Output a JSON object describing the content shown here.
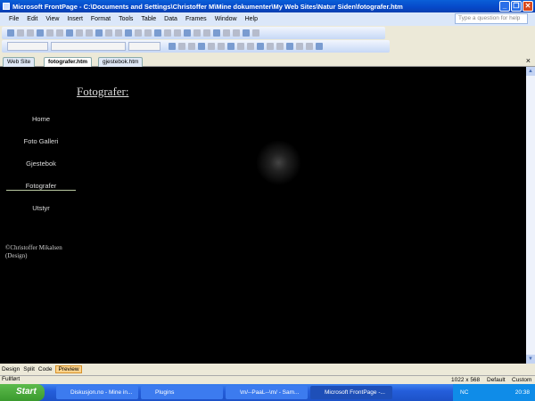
{
  "window": {
    "title": "Microsoft FrontPage - C:\\Documents and Settings\\Christoffer M\\Mine dokumenter\\My Web Sites\\Natur Siden\\fotografer.htm",
    "minimize": "_",
    "maximize": "❐",
    "close": "✕"
  },
  "menu": [
    "File",
    "Edit",
    "View",
    "Insert",
    "Format",
    "Tools",
    "Table",
    "Data",
    "Frames",
    "Window",
    "Help"
  ],
  "help_placeholder": "Type a question for help",
  "tabs": [
    "Web Site",
    "fotografer.htm",
    "gjestebok.htm"
  ],
  "tab_close": "×",
  "page": {
    "title": "Fotografer:",
    "nav": [
      "Home",
      "Foto Galleri",
      "Gjestebok",
      "Fotografer",
      "Utstyr"
    ],
    "copyright1": "©Christoffer Mikalsen",
    "copyright2": "(Design)"
  },
  "views": [
    "Design",
    "Split",
    "Code",
    "Preview"
  ],
  "status": {
    "left": "Fullført",
    "size": "1022 x 568",
    "mode1": "Default",
    "mode2": "Custom"
  },
  "taskbar": {
    "start": "Start",
    "tasks": [
      "Diskusjon.no - Mine in...",
      "Plugins",
      "\\m/--PaaL--\\m/ - Sam...",
      "Microsoft FrontPage -..."
    ],
    "tray_lang": "NC",
    "clock": "20:38"
  }
}
